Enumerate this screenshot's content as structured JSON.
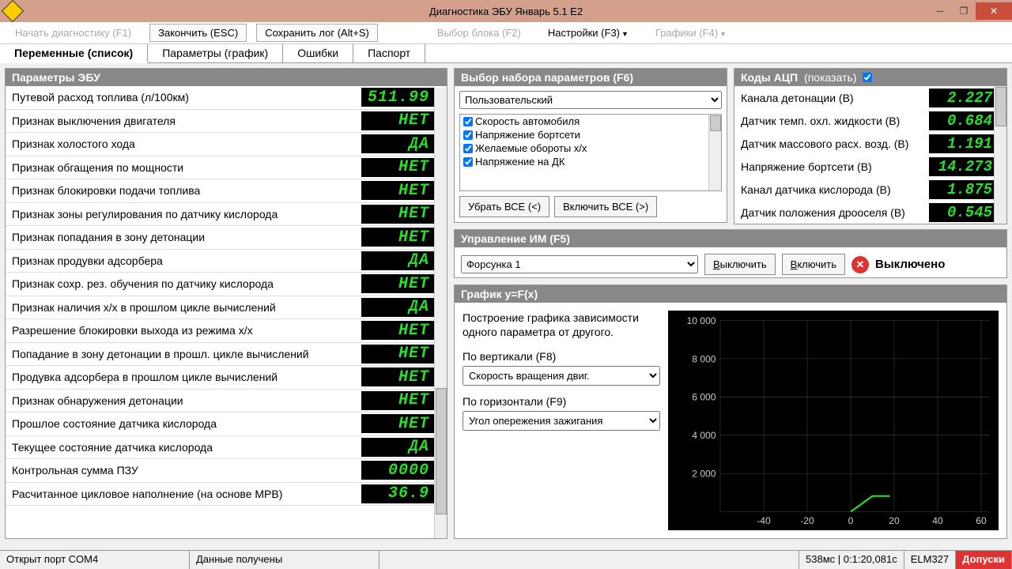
{
  "title": "Диагностика ЭБУ Январь 5.1 Е2",
  "toolbar": {
    "start": "Начать диагностику (F1)",
    "finish": "Закончить (ESC)",
    "savelog": "Сохранить лог (Alt+S)",
    "selblock": "Выбор блока (F2)",
    "settings": "Настройки (F3)",
    "graphics": "Графики (F4)"
  },
  "tabs": {
    "t1": "Переменные (список)",
    "t2": "Параметры (график)",
    "t3": "Ошибки",
    "t4": "Паспорт"
  },
  "paramhdr": "Параметры ЭБУ",
  "params": [
    {
      "label": "Путевой расход топлива (л/100км)",
      "val": "511.99"
    },
    {
      "label": "Признак выключения двигателя",
      "val": "НЕТ"
    },
    {
      "label": "Признак холостого хода",
      "val": "ДА"
    },
    {
      "label": "Признак обгащения по мощности",
      "val": "НЕТ"
    },
    {
      "label": "Признак блокировки подачи топлива",
      "val": "НЕТ"
    },
    {
      "label": "Признак зоны регулирования по датчику кислорода",
      "val": "НЕТ"
    },
    {
      "label": "Признак попадания в зону детонации",
      "val": "НЕТ"
    },
    {
      "label": "Признак продувки адсорбера",
      "val": "ДА"
    },
    {
      "label": "Признак сохр. рез. обучения по датчику кислорода",
      "val": "НЕТ"
    },
    {
      "label": "Признак наличия х/х в прошлом цикле вычислений",
      "val": "ДА"
    },
    {
      "label": "Разрешение блокировки выхода из режима х/х",
      "val": "НЕТ"
    },
    {
      "label": "Попадание в зону детонации в прошл. цикле вычислений",
      "val": "НЕТ"
    },
    {
      "label": "Продувка адсорбера в прошлом цикле вычислений",
      "val": "НЕТ"
    },
    {
      "label": "Признак обнаружения детонации",
      "val": "НЕТ"
    },
    {
      "label": "Прошлое состояние датчика кислорода",
      "val": "НЕТ"
    },
    {
      "label": "Текущее состояние датчика кислорода",
      "val": "ДА"
    },
    {
      "label": "Контрольная сумма ПЗУ",
      "val": "0000"
    },
    {
      "label": "Расчитанное цикловое наполнение (на основе МРВ)",
      "val": "36.9"
    }
  ],
  "psel": {
    "hdr": "Выбор набора параметров (F6)",
    "value": "Пользовательский",
    "items": [
      "Скорость автомобиля",
      "Напряжение бортсети",
      "Желаемые обороты х/х",
      "Напряжение на ДК"
    ],
    "removeall": "Убрать ВСЕ (<)",
    "addall": "Включить ВСЕ (>)"
  },
  "adc": {
    "hdr": "Коды АЦП",
    "show": "(показать)",
    "rows": [
      {
        "label": "Канала детонации (В)",
        "val": "2.227"
      },
      {
        "label": "Датчик темп. охл. жидкости (В)",
        "val": "0.684"
      },
      {
        "label": "Датчик массового расх. возд. (В)",
        "val": "1.191"
      },
      {
        "label": "Напряжение бортсети (В)",
        "val": "14.273"
      },
      {
        "label": "Канал датчика кислорода (В)",
        "val": "1.875"
      },
      {
        "label": "Датчик положения дрооселя (В)",
        "val": "0.545"
      }
    ]
  },
  "act": {
    "hdr": "Управление ИМ (F5)",
    "sel": "Форсунка 1",
    "off": "Выключить",
    "on": "Включить",
    "state": "Выключено"
  },
  "graph": {
    "hdr": "График y=F(x)",
    "desc": "Построение графика зависимости одного параметра от другого.",
    "vlabel": "По вертикали (F8)",
    "vsel": "Скорость вращения двиг.",
    "hlabel": "По горизонтали (F9)",
    "hsel": "Угол опережения зажигания"
  },
  "status": {
    "port": "Открыт порт COM4",
    "data": "Данные получены",
    "time": "538мс | 0:1:20,081с",
    "adapter": "ELM327",
    "dopuski": "Допуски"
  },
  "chart_data": {
    "type": "line",
    "title": "",
    "xlabel": "",
    "ylabel": "",
    "xlim": [
      -60,
      60
    ],
    "ylim": [
      0,
      10000
    ],
    "xticks": [
      -40,
      -20,
      0,
      20,
      40,
      60
    ],
    "yticks": [
      2000,
      4000,
      6000,
      8000,
      10000
    ],
    "series": [
      {
        "name": "trace",
        "x": [
          0,
          10,
          18
        ],
        "y": [
          0,
          800,
          800
        ],
        "color": "#2bdd2b"
      }
    ]
  }
}
